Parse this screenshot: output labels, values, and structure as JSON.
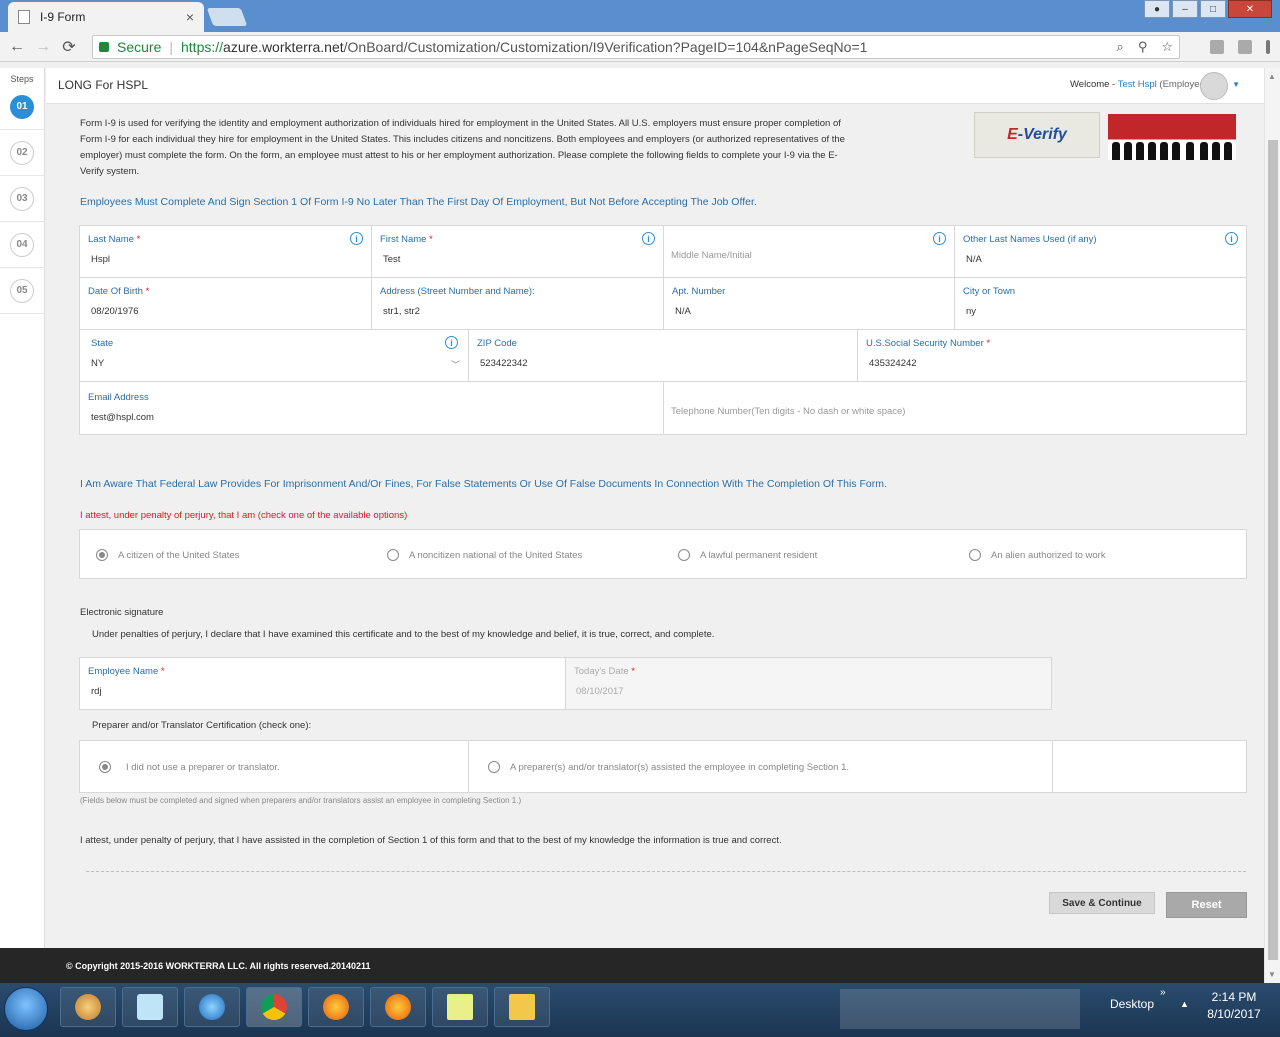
{
  "browser": {
    "tab_title": "I-9 Form",
    "tab_close": "×",
    "secure_label": "Secure",
    "url_scheme": "https://",
    "url_host": "azure.workterra.net",
    "url_path": "/OnBoard/Customization/Customization/I9Verification?PageID=104&nPageSeqNo=1",
    "nav_back": "←",
    "nav_forward": "→",
    "nav_reload": "⟳"
  },
  "steps": {
    "label": "Steps",
    "items": [
      "01",
      "02",
      "03",
      "04",
      "05"
    ]
  },
  "header": {
    "company": "LONG For HSPL",
    "welcome": "Welcome -",
    "user_name": "Test Hspl",
    "user_role": "(Employee)"
  },
  "intro": {
    "text": "Form I-9 is used for verifying the identity and employment authorization of individuals hired for employment in the United States. All U.S. employers must ensure proper completion of Form I-9 for each individual they hire for employment in the United States. This includes citizens and noncitizens. Both employees and employers (or authorized representatives of the employer) must complete the form. On the form, an employee must attest to his or her employment authorization. Please complete the following fields to complete your I-9 via the E-Verify system.",
    "logo_e": "E",
    "logo_verify": "-Verify"
  },
  "instruction": "Employees Must Complete And Sign Section 1 Of Form I-9 No Later Than The First Day Of Employment, But Not Before Accepting The Job Offer.",
  "fields": {
    "last_name": {
      "label": "Last Name",
      "value": "Hspl"
    },
    "first_name": {
      "label": "First Name",
      "value": "Test"
    },
    "middle_name": {
      "placeholder": "Middle Name/Initial"
    },
    "other_last_names": {
      "label": "Other Last Names Used (if any)",
      "value": "N/A"
    },
    "dob": {
      "label": "Date Of Birth",
      "value": "08/20/1976"
    },
    "address": {
      "label": "Address (Street Number and Name):",
      "value": "str1, str2"
    },
    "apt": {
      "label": "Apt. Number",
      "value": "N/A"
    },
    "city": {
      "label": "City or Town",
      "value": "ny"
    },
    "state": {
      "label": "State",
      "value": "NY"
    },
    "zip": {
      "label": "ZIP Code",
      "value": "523422342"
    },
    "ssn": {
      "label": "U.S.Social Security Number",
      "value": "435324242"
    },
    "email": {
      "label": "Email Address",
      "value": "test@hspl.com"
    },
    "phone": {
      "placeholder": "Telephone Number(Ten digits - No dash or white space)"
    },
    "required_mark": "*",
    "info_glyph": "i"
  },
  "aware_text": "I Am Aware That Federal Law Provides For Imprisonment And/Or Fines, For False Statements Or Use Of False Documents In Connection With The Completion Of This Form.",
  "attest_red": "I attest, under penalty of perjury, that I am (check one of the available options)",
  "status_options": [
    {
      "label": "A citizen of the United States",
      "checked": true
    },
    {
      "label": "A noncitizen national of the United States",
      "checked": false
    },
    {
      "label": "A lawful permanent resident",
      "checked": false
    },
    {
      "label": "An alien authorized to work",
      "checked": false
    }
  ],
  "signature": {
    "title": "Electronic signature",
    "text": "Under penalties of perjury, I declare that I have examined this certificate and to the best of my knowledge and belief, it is true, correct, and complete.",
    "employee_name_label": "Employee Name",
    "employee_name_value": "rdj",
    "todays_date_label": "Today's Date",
    "todays_date_value": "08/10/2017"
  },
  "preparer": {
    "title": "Preparer and/or Translator Certification (check one):",
    "option_none": "I did not use a preparer or translator.",
    "option_assisted": "A preparer(s) and/or translator(s) assisted the employee in completing Section 1.",
    "note": "(Fields below must be completed and signed when preparers and/or translators assist an employee in completing Section 1.)",
    "attest": "I attest, under penalty of perjury, that I have assisted in the completion of Section 1 of this form and that to the best of my knowledge the information is true and correct."
  },
  "buttons": {
    "save": "Save & Continue",
    "reset": "Reset"
  },
  "footer": {
    "copyright": "© Copyright 2015-2016 WORKTERRA LLC. All rights reserved.20140211"
  },
  "taskbar": {
    "desktop": "Desktop",
    "time": "2:14 PM",
    "date": "8/10/2017"
  },
  "colors": {
    "accent": "#2a8fd6",
    "label_blue": "#2a6fa6",
    "required_red": "#d62020",
    "footer_bg": "#262626"
  }
}
